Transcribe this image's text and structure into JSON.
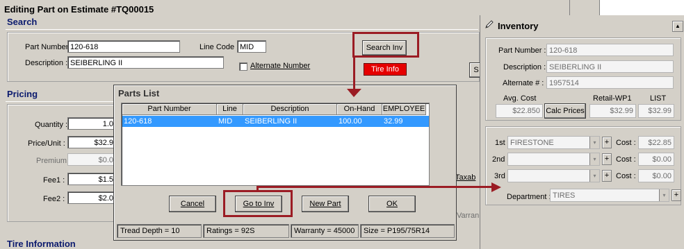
{
  "estimate_window": {
    "title": "Editing Part on Estimate #TQ00015",
    "search_section": "Search",
    "part_number_label": "Part Number :",
    "part_number_value": "120-618",
    "line_code_label": "Line Code :",
    "line_code_value": "MID",
    "description_label": "Description :",
    "description_value": "SEIBERLING II",
    "alternate_number_label": "Alternate Number",
    "search_inv_label": "Search Inv",
    "tire_info_label": "Tire Info",
    "side_button_partial": "S",
    "pricing_section": "Pricing",
    "quantity_label": "Quantity :",
    "quantity_value": "1.0",
    "price_unit_label": "Price/Unit :",
    "price_unit_value": "$32.9",
    "premium_label": "Premium",
    "premium_value": "$0.0",
    "fee1_label": "Fee1 :",
    "fee1_value": "$1.5",
    "fee2_label": "Fee2 :",
    "fee2_value": "$2.0",
    "taxable_partial": "Taxab",
    "warranty_partial": "Varran",
    "tire_information_section": "Tire Information"
  },
  "parts_list": {
    "title": "Parts List",
    "columns": [
      "Part Number",
      "Line",
      "Description",
      "On-Hand",
      "EMPLOYEE"
    ],
    "row": {
      "part_number": "120-618",
      "line": "MID",
      "description": "SEIBERLING II",
      "on_hand": "100.00",
      "employee": "32.99"
    },
    "cancel_label": "Cancel",
    "go_to_inv_label": "Go to Inv",
    "new_part_label": "New Part",
    "ok_label": "OK",
    "status": {
      "tread_depth": "Tread Depth = 10",
      "ratings": "Ratings = 92S",
      "warranty": "Warranty = 45000",
      "size": "Size = P195/75R14"
    }
  },
  "inventory": {
    "title": "Inventory",
    "part_number_label": "Part Number :",
    "part_number_value": "120-618",
    "description_label": "Description :",
    "description_value": "SEIBERLING II",
    "alternate_label": "Alternate # :",
    "alternate_value": "1957514",
    "avg_cost_label": "Avg. Cost",
    "avg_cost_value": "$22.850",
    "calc_prices_label": "Calc Prices",
    "retail_label": "Retail-WP1",
    "retail_value": "$32.99",
    "list_label": "LIST",
    "list_value": "$32.99",
    "vendor1_label": "1st",
    "vendor1_value": "FIRESTONE",
    "vendor1_cost_label": "Cost :",
    "vendor1_cost": "$22.85",
    "vendor2_label": "2nd",
    "vendor2_value": "",
    "vendor2_cost_label": "Cost :",
    "vendor2_cost": "$0.00",
    "vendor3_label": "3rd",
    "vendor3_value": "",
    "vendor3_cost_label": "Cost :",
    "vendor3_cost": "$0.00",
    "department_label": "Department :",
    "department_value": "TIRES",
    "plus_label": "+"
  },
  "icons": {
    "pencil": "pencil-icon",
    "dropdown": "▾",
    "scroll_up": "▲"
  },
  "colors": {
    "section_title": "#0b1a6e",
    "highlight": "#9b1c24",
    "selection": "#3399ff",
    "tire_info_button": "#e60000"
  }
}
